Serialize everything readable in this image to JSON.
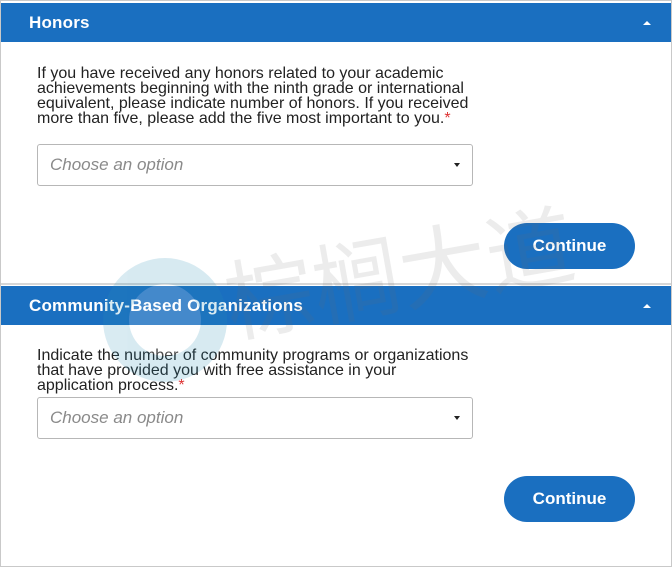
{
  "honors": {
    "title": "Honors",
    "question": "If you have received any honors related to your academic achievements beginning with the ninth grade or international equivalent, please indicate number of honors. If you received more than five, please add the five most important to you.",
    "required_mark": "*",
    "select_placeholder": "Choose an option",
    "continue_label": "Continue"
  },
  "community": {
    "title": "Community-Based Organizations",
    "question": "Indicate the number of community programs or organizations that have provided you with free assistance in your application process.",
    "required_mark": "*",
    "select_placeholder": "Choose an option",
    "continue_label": "Continue"
  },
  "watermark": {
    "text": "棕榈大道"
  },
  "colors": {
    "accent": "#1a6fc0",
    "required": "#dd3333"
  }
}
